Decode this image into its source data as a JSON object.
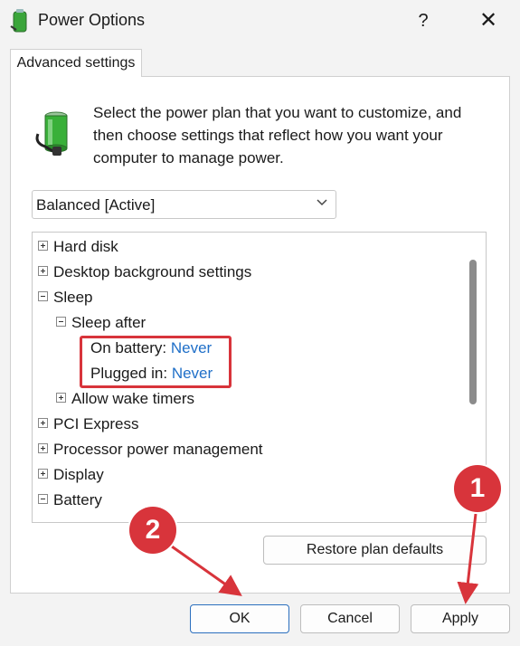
{
  "window": {
    "title": "Power Options",
    "help_glyph": "?",
    "close_glyph": "✕"
  },
  "tab": {
    "label": "Advanced settings"
  },
  "description": "Select the power plan that you want to customize, and then choose settings that reflect how you want your computer to manage power.",
  "plan_select": {
    "value": "Balanced [Active]"
  },
  "tree": {
    "hard_disk": "Hard disk",
    "desktop_bg": "Desktop background settings",
    "sleep": "Sleep",
    "sleep_after": "Sleep after",
    "on_battery_label": "On battery:",
    "on_battery_value": "Never",
    "plugged_in_label": "Plugged in:",
    "plugged_in_value": "Never",
    "wake_timers": "Allow wake timers",
    "pci_express": "PCI Express",
    "processor": "Processor power management",
    "display": "Display",
    "battery": "Battery"
  },
  "buttons": {
    "restore": "Restore plan defaults",
    "ok": "OK",
    "cancel": "Cancel",
    "apply": "Apply"
  },
  "annotations": {
    "step1": "1",
    "step2": "2"
  },
  "colors": {
    "highlight": "#d8343b",
    "value_link": "#1f6fc8",
    "accent": "#2b6fbe"
  }
}
